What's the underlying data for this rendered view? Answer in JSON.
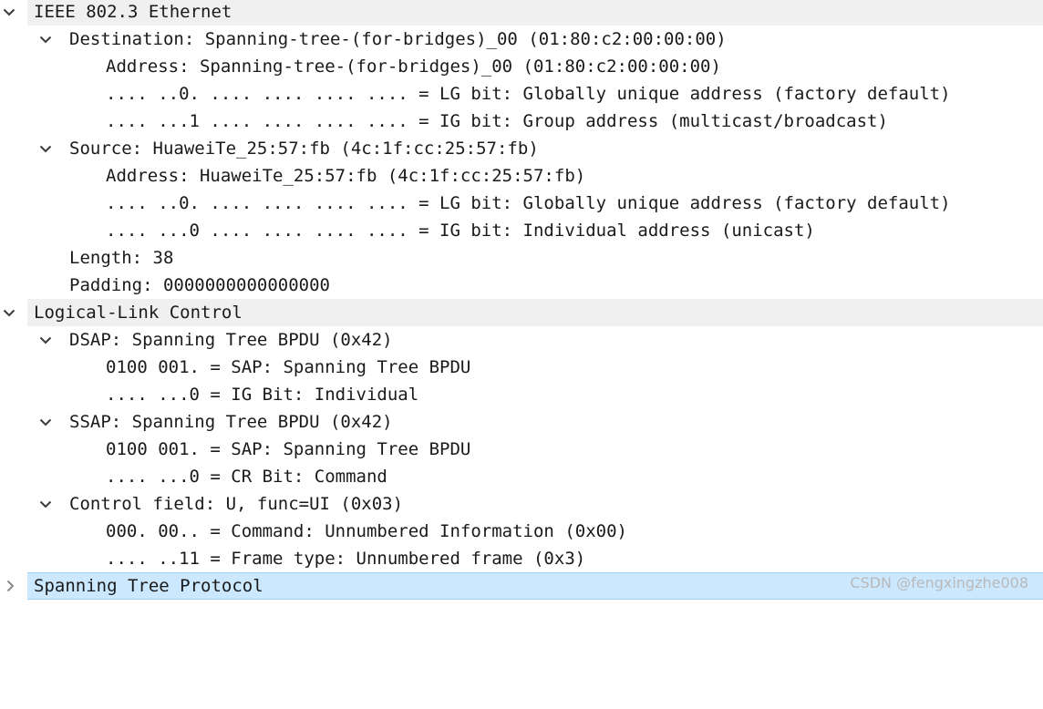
{
  "tree": {
    "ethernet": {
      "label": "IEEE 802.3 Ethernet",
      "expanded": true,
      "destination": {
        "label": "Destination: Spanning-tree-(for-bridges)_00 (01:80:c2:00:00:00)",
        "expanded": true,
        "address": "Address: Spanning-tree-(for-bridges)_00 (01:80:c2:00:00:00)",
        "lg_bit": ".... ..0. .... .... .... .... = LG bit: Globally unique address (factory default)",
        "ig_bit": ".... ...1 .... .... .... .... = IG bit: Group address (multicast/broadcast)"
      },
      "source": {
        "label": "Source: HuaweiTe_25:57:fb (4c:1f:cc:25:57:fb)",
        "expanded": true,
        "address": "Address: HuaweiTe_25:57:fb (4c:1f:cc:25:57:fb)",
        "lg_bit": ".... ..0. .... .... .... .... = LG bit: Globally unique address (factory default)",
        "ig_bit": ".... ...0 .... .... .... .... = IG bit: Individual address (unicast)"
      },
      "length": "Length: 38",
      "padding": "Padding: 0000000000000000"
    },
    "llc": {
      "label": "Logical-Link Control",
      "expanded": true,
      "dsap": {
        "label": "DSAP: Spanning Tree BPDU (0x42)",
        "expanded": true,
        "sap": "0100 001. = SAP: Spanning Tree BPDU",
        "ig_bit": ".... ...0 = IG Bit: Individual"
      },
      "ssap": {
        "label": "SSAP: Spanning Tree BPDU (0x42)",
        "expanded": true,
        "sap": "0100 001. = SAP: Spanning Tree BPDU",
        "cr_bit": ".... ...0 = CR Bit: Command"
      },
      "control": {
        "label": "Control field: U, func=UI (0x03)",
        "expanded": true,
        "command": "000. 00.. = Command: Unnumbered Information (0x00)",
        "frame_type": ".... ..11 = Frame type: Unnumbered frame (0x3)"
      }
    },
    "stp": {
      "label": "Spanning Tree Protocol",
      "expanded": false,
      "selected": true
    }
  },
  "watermark": "CSDN @fengxingzhe008",
  "colors": {
    "group_bg": "#f0f0f0",
    "selected_bg": "#cce8ff",
    "selected_border": "#99d1ff",
    "text": "#1a1a1a",
    "arrow": "#3a3a3a"
  },
  "icons": {
    "expanded": "chevron-down-icon",
    "collapsed": "chevron-right-icon"
  }
}
